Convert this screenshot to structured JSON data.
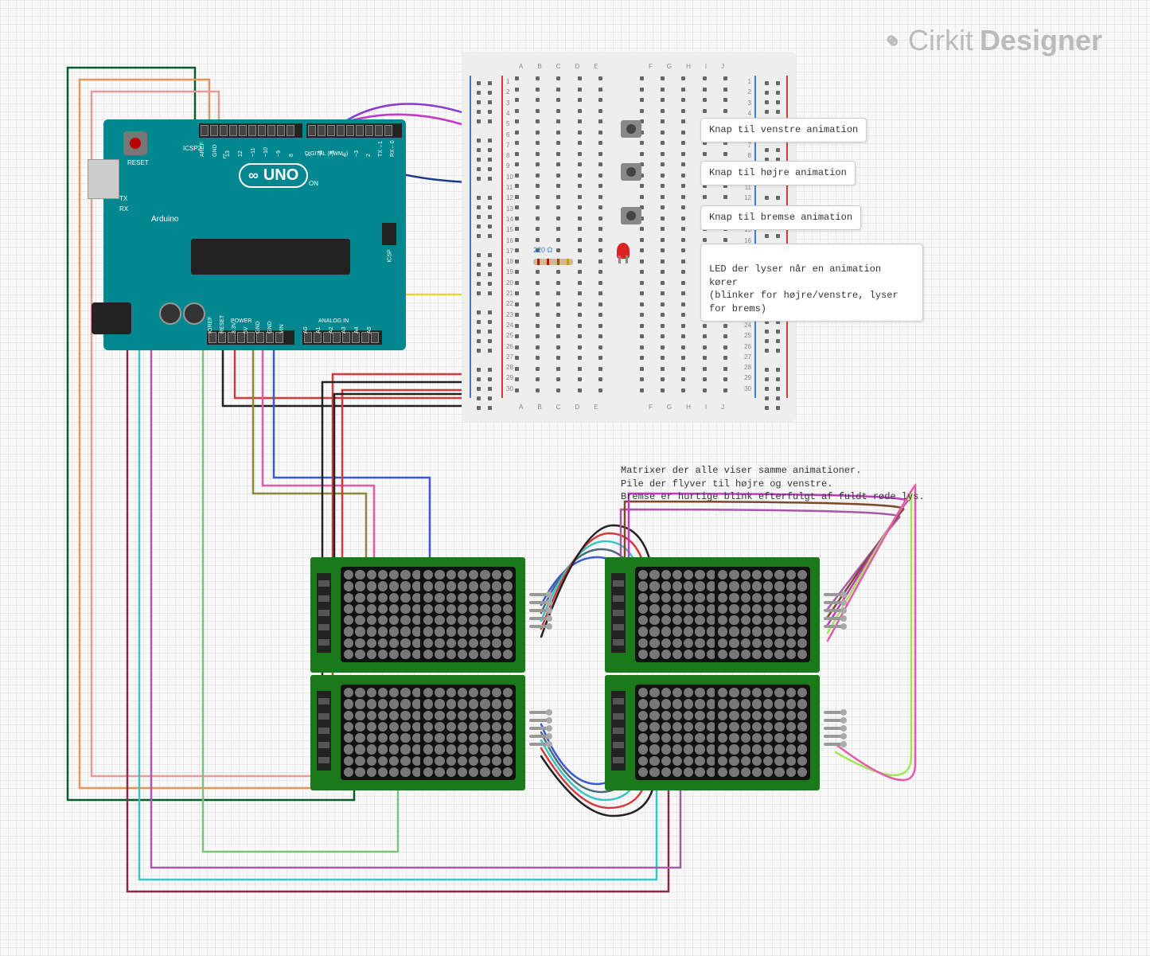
{
  "brand": {
    "name1": "Cirkit",
    "name2": "Designer"
  },
  "arduino": {
    "board": "Arduino",
    "model": "UNO",
    "reset": "RESET",
    "on": "ON",
    "tx": "TX",
    "rx": "RX",
    "icsp": "ICSP",
    "icsp2": "ICSP2",
    "l": "L",
    "digital_label": "DIGITAL (PWM~)",
    "power_label": "POWER",
    "analog_label": "ANALOG IN",
    "top_pins": [
      "AREF",
      "GND",
      "13",
      "12",
      "~11",
      "~10",
      "~9",
      "8",
      "7",
      "~6",
      "~5",
      "4",
      "~3",
      "2",
      "TX→1",
      "RX←0"
    ],
    "bottom_pins": [
      "IOREF",
      "RESET",
      "3.3V",
      "5V",
      "GND",
      "GND",
      "VIN",
      "A0",
      "A1",
      "A2",
      "A3",
      "A4",
      "A5"
    ]
  },
  "breadboard": {
    "cols_left": [
      "A",
      "B",
      "C",
      "D",
      "E"
    ],
    "cols_right": [
      "F",
      "G",
      "H",
      "I",
      "J"
    ],
    "rows": 30,
    "row_numbers": [
      1,
      2,
      3,
      4,
      5,
      6,
      7,
      8,
      9,
      10,
      11,
      12,
      13,
      14,
      15,
      16,
      17,
      18,
      19,
      20,
      21,
      22,
      23,
      24,
      25,
      26,
      27,
      28,
      29,
      30
    ]
  },
  "components": {
    "resistor_value": "220 Ω"
  },
  "notes": {
    "btn_left": "Knap til venstre animation",
    "btn_right": "Knap til højre animation",
    "btn_brake": "Knap til bremse animation",
    "led": "LED der lyser når en animation kører\n(blinker for højre/venstre, lyser for brems)",
    "matrix": "Matrixer der alle viser samme animationer.\nPile der flyver til højre og venstre.\nBremse er hurtige blink efterfulgt af fuldt røde lys."
  },
  "colors": {
    "darkgreen": "#0a5a2a",
    "lightgreen": "#7cc47c",
    "orange": "#e8955a",
    "salmon": "#e89a9a",
    "pink": "#e85aa8",
    "magenta": "#c43ac4",
    "purple": "#8a3ad5",
    "navy": "#1a3a8a",
    "blue": "#3a5ad5",
    "teal": "#3ac4c4",
    "yellow": "#e8d43a",
    "red": "#d53a3a",
    "black": "#222",
    "olive": "#8a8a3a",
    "brown": "#7a4a2a",
    "slate": "#4a6a7a",
    "plum": "#a85aa8",
    "lime": "#9ee85a",
    "maroon": "#8a2a4a"
  }
}
